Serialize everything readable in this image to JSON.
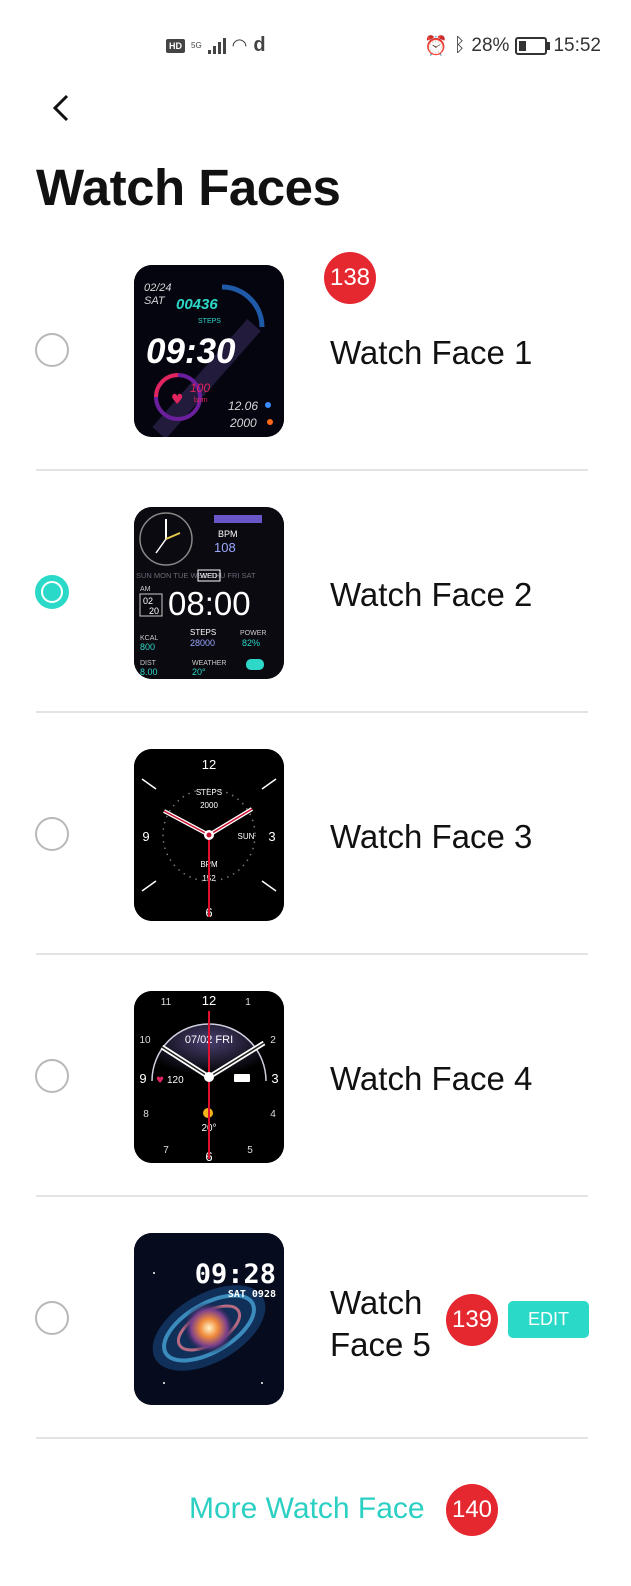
{
  "status_bar": {
    "left_hd": "HD",
    "left_net": "5G",
    "left_d": "d",
    "battery": "28%",
    "time": "15:52"
  },
  "header": {
    "title": "Watch Faces"
  },
  "faces": [
    {
      "label": "Watch Face 1",
      "selected": false,
      "badge": "138",
      "screen": {
        "date": "02/24",
        "day": "SAT",
        "steps": "00436",
        "steps_label": "STEPS",
        "time": "09:30",
        "heart": "100",
        "heart_unit": "bpm",
        "stat1": "12.06",
        "stat2": "2000"
      }
    },
    {
      "label": "Watch Face 2",
      "selected": true,
      "screen": {
        "bpm_label": "BPM",
        "bpm": "108",
        "days": "SUN MON TUE WED THU FRI SAT",
        "current_day": "WED",
        "am": "AM",
        "date_m": "02",
        "date_d": "20",
        "time": "08:00",
        "kcal_label": "KCAL",
        "kcal": "800",
        "steps_label": "STEPS",
        "steps": "28000",
        "power_label": "POWER",
        "power": "82%",
        "dist_label": "DIST",
        "dist": "8.00",
        "weather_label": "WEATHER",
        "weather": "20°"
      }
    },
    {
      "label": "Watch Face 3",
      "selected": false,
      "screen": {
        "n12": "12",
        "n3": "3",
        "n6": "6",
        "n9": "9",
        "steps_label": "STEPS",
        "steps": "2000",
        "day": "SUN",
        "bpm_label": "BPM",
        "bpm": "152"
      }
    },
    {
      "label": "Watch Face 4",
      "selected": false,
      "screen": {
        "date": "07/02  FRI",
        "heart": "120",
        "temp": "20°",
        "n1": "1",
        "n2": "2",
        "n3": "3",
        "n4": "4",
        "n5": "5",
        "n6": "6",
        "n7": "7",
        "n8": "8",
        "n9": "9",
        "n10": "10",
        "n11": "11",
        "n12": "12"
      }
    },
    {
      "label": "Watch Face 5",
      "selected": false,
      "badge": "139",
      "edit_label": "EDIT",
      "screen": {
        "time": "09:28",
        "date": "SAT 0928"
      }
    }
  ],
  "more": {
    "label": "More Watch Face",
    "badge": "140"
  },
  "colors": {
    "accent": "#2bd9c9",
    "badge": "#e5282f",
    "divider": "#e3e3e3"
  }
}
